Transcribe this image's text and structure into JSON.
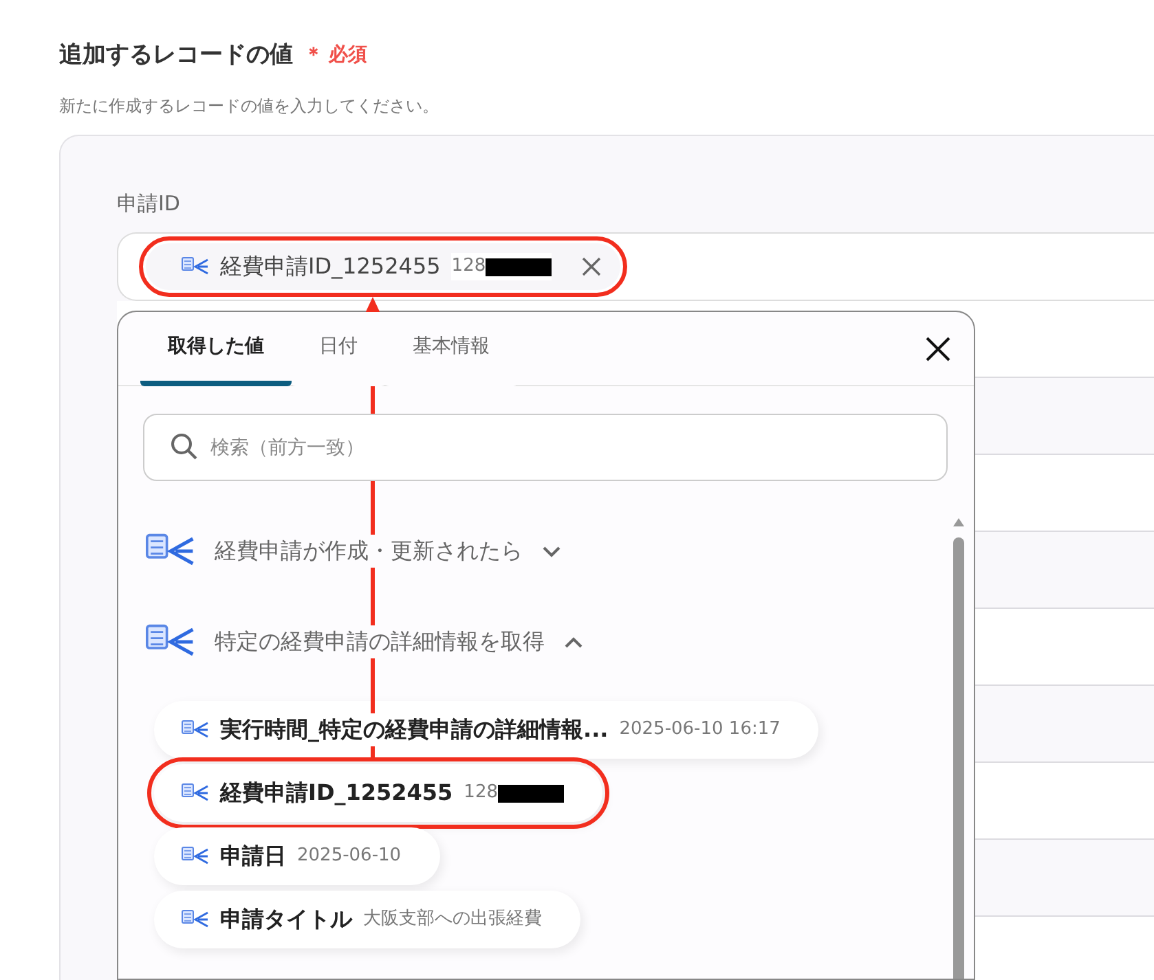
{
  "section": {
    "title": "追加するレコードの値",
    "required_mark": "＊",
    "required_label": "必須",
    "description": "新たに作成するレコードの値を入力してください。"
  },
  "field": {
    "label": "申請ID",
    "chip": {
      "name": "経費申請ID_1252455",
      "value": "128",
      "redacted": true,
      "highlighted": true
    }
  },
  "popup": {
    "tabs": [
      {
        "label": "取得した値",
        "selected": true
      },
      {
        "label": "日付",
        "selected": false
      },
      {
        "label": "基本情報",
        "selected": false
      }
    ],
    "search": {
      "placeholder": "検索（前方一致）"
    },
    "groups": [
      {
        "title": "経費申請が作成・更新されたら",
        "expanded": false
      },
      {
        "title": "特定の経費申請の詳細情報を取得",
        "expanded": true,
        "items": [
          {
            "name": "実行時間_特定の経費申請の詳細情報...",
            "value": "2025-06-10 16:17",
            "redacted": false,
            "highlighted": false
          },
          {
            "name": "経費申請ID_1252455",
            "value": "128",
            "redacted": true,
            "highlighted": true
          },
          {
            "name": "申請日",
            "value": "2025-06-10",
            "redacted": false,
            "highlighted": false
          },
          {
            "name": "申請タイトル",
            "value": "大阪支部への出張経費",
            "redacted": false,
            "highlighted": false
          }
        ]
      }
    ]
  }
}
